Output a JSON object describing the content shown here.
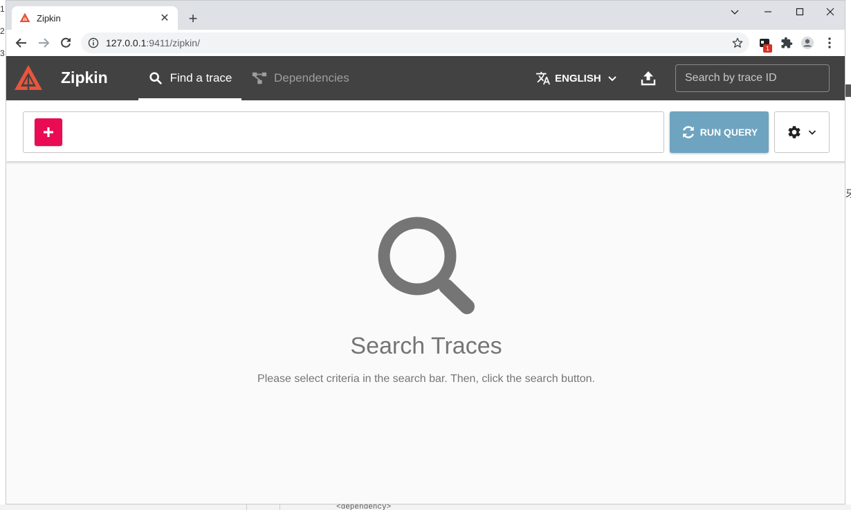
{
  "background": {
    "left_numbers": [
      "1",
      "2",
      "3"
    ],
    "right_glyph": "牙",
    "bottom_code": "<dependency>"
  },
  "browser": {
    "tab": {
      "title": "Zipkin",
      "close": "✕"
    },
    "new_tab": "+",
    "url_host": "127.0.0.1",
    "url_path": ":9411/zipkin/",
    "extension_badge": "1"
  },
  "app": {
    "brand": "Zipkin",
    "nav": {
      "find": "Find a trace",
      "deps": "Dependencies"
    },
    "language": "ENGLISH",
    "trace_search_placeholder": "Search by trace ID",
    "colors": {
      "header": "#424242",
      "accent_add": "#ea0b55",
      "run_query": "#6ea4bf",
      "logo": "#e8553c"
    }
  },
  "query": {
    "run_label": "RUN QUERY"
  },
  "empty_state": {
    "title": "Search Traces",
    "description": "Please select criteria in the search bar. Then, click the search button."
  }
}
